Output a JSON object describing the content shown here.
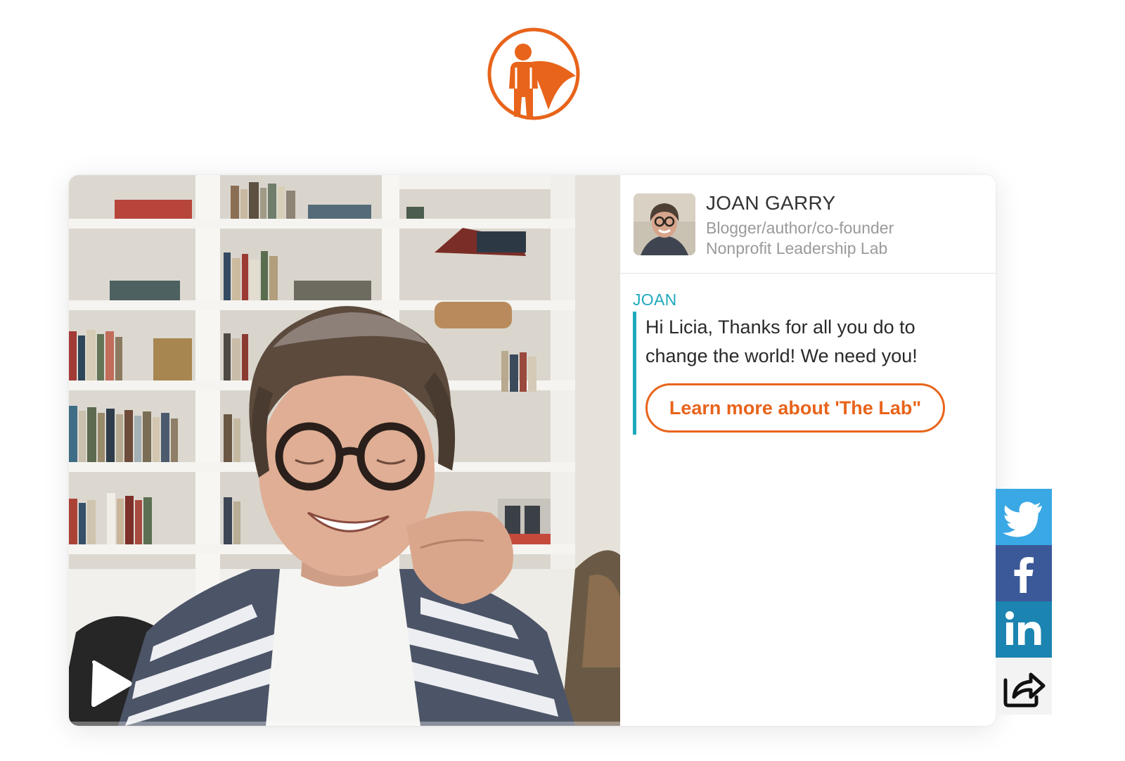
{
  "brand": {
    "logo_icon": "caped-person-logo-icon",
    "accent_color": "#e8641b"
  },
  "video": {
    "play_icon": "play-icon",
    "state": "paused"
  },
  "profile": {
    "name": "JOAN GARRY",
    "role": "Blogger/author/co-founder",
    "organization": "Nonprofit Leadership Lab"
  },
  "message": {
    "author": "JOAN",
    "author_color": "#1fa9bd",
    "text": "Hi Licia, Thanks for all you do to change the world! We need you!",
    "cta_label": "Learn more about 'The Lab\""
  },
  "share_bar": {
    "items": [
      {
        "icon": "twitter-icon",
        "color": "#3aa8e4"
      },
      {
        "icon": "facebook-icon",
        "color": "#3b5998"
      },
      {
        "icon": "linkedin-icon",
        "color": "#1b84b0"
      },
      {
        "icon": "share-icon",
        "color": "#f3f3f3"
      }
    ]
  }
}
